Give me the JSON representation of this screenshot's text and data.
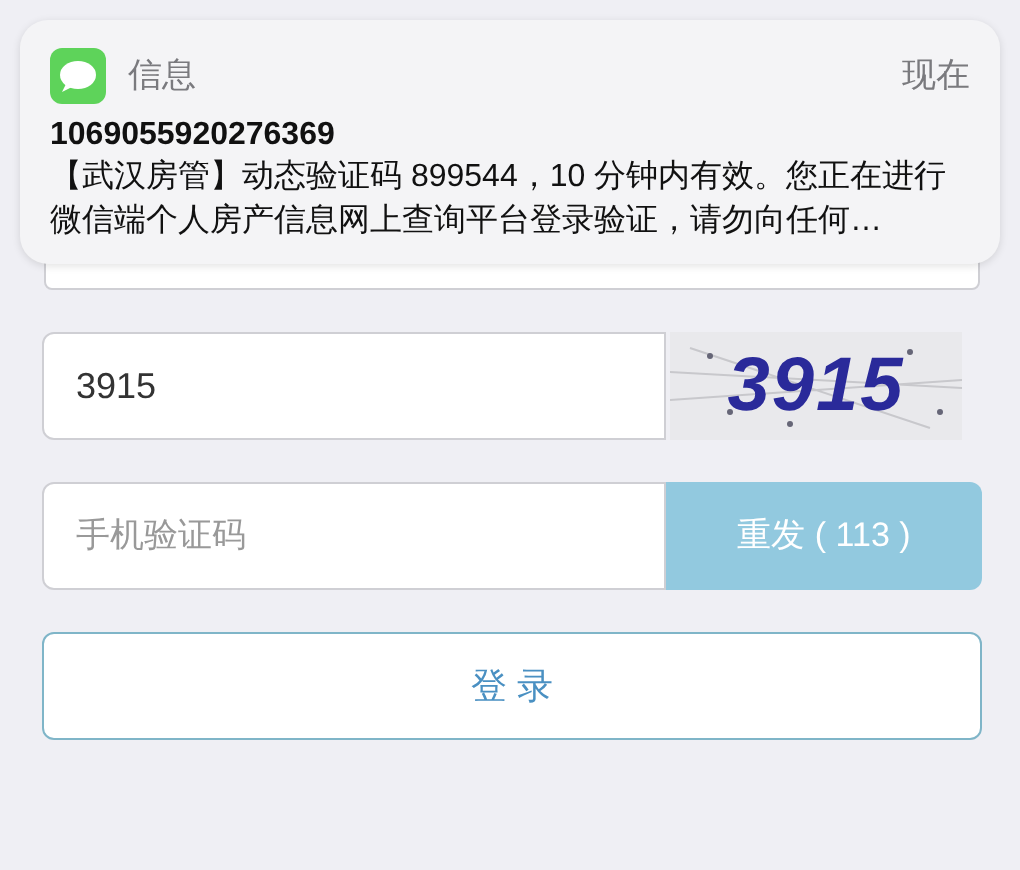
{
  "notification": {
    "app": "信息",
    "time": "现在",
    "sender": "1069055920276369",
    "message": "【武汉房管】动态验证码 899544，10 分钟内有效。您正在进行微信端个人房产信息网上查询平台登录验证，请勿向任何…"
  },
  "captcha_field": {
    "value": "3915"
  },
  "captcha_image": {
    "text": "3915"
  },
  "sms_field": {
    "placeholder": "手机验证码"
  },
  "resend_button": {
    "label": "重发 ( 113 )",
    "disabled": true
  },
  "login_button": {
    "label": "登 录"
  }
}
